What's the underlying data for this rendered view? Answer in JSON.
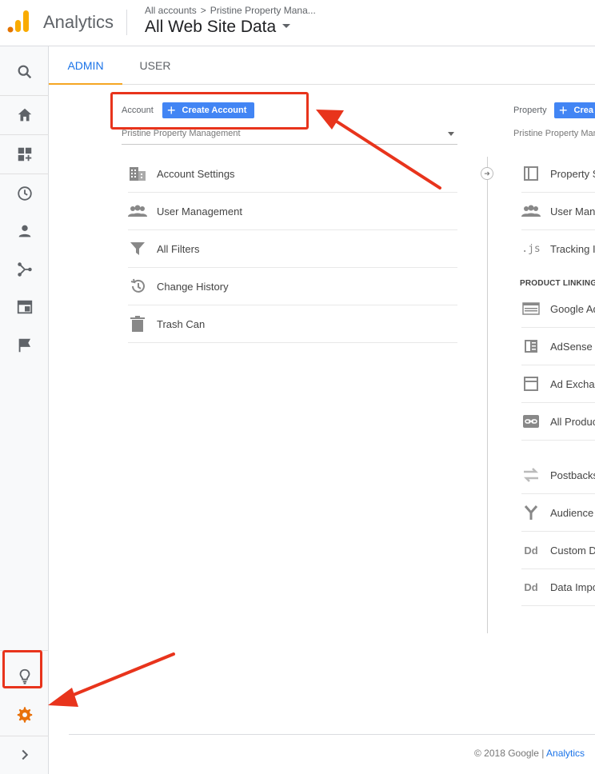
{
  "header": {
    "app_name": "Analytics",
    "breadcrumb": [
      "All accounts",
      "Pristine Property Mana..."
    ],
    "view_title": "All Web Site Data"
  },
  "left_nav": {
    "items": [
      {
        "icon": "search-icon"
      },
      {
        "icon": "home-icon"
      },
      {
        "icon": "customization-icon"
      },
      {
        "icon": "realtime-clock-icon"
      },
      {
        "icon": "audience-person-icon"
      },
      {
        "icon": "acquisition-icon"
      },
      {
        "icon": "behavior-icon"
      },
      {
        "icon": "conversions-flag-icon"
      }
    ],
    "bottom": [
      {
        "icon": "discover-lightbulb-icon"
      },
      {
        "icon": "admin-gear-icon"
      },
      {
        "icon": "expand-chevron-icon"
      }
    ]
  },
  "tabs": [
    {
      "label": "ADMIN",
      "active": true
    },
    {
      "label": "USER",
      "active": false
    }
  ],
  "account": {
    "label": "Account",
    "create_button": "Create Account",
    "selected": "Pristine Property Management",
    "items": [
      {
        "label": "Account Settings",
        "icon": "building-icon"
      },
      {
        "label": "User Management",
        "icon": "people-icon"
      },
      {
        "label": "All Filters",
        "icon": "filter-icon"
      },
      {
        "label": "Change History",
        "icon": "history-icon"
      },
      {
        "label": "Trash Can",
        "icon": "trash-icon"
      }
    ]
  },
  "property": {
    "label": "Property",
    "create_button": "Crea",
    "selected": "Pristine Property Mana",
    "items": [
      {
        "label": "Property S",
        "icon": "property-settings-icon"
      },
      {
        "label": "User Mana",
        "icon": "people-icon"
      },
      {
        "label": "Tracking In",
        "icon": "js-icon"
      }
    ],
    "section_heading": "PRODUCT LINKING",
    "linking_items": [
      {
        "label": "Google Ad",
        "icon": "google-ads-icon"
      },
      {
        "label": "AdSense L",
        "icon": "adsense-icon"
      },
      {
        "label": "Ad Exchan",
        "icon": "ad-exchange-icon"
      },
      {
        "label": "All Produc",
        "icon": "link-icon"
      }
    ],
    "other_items": [
      {
        "label": "Postbacks",
        "icon": "postbacks-icon"
      },
      {
        "label": "Audience D",
        "icon": "audience-fork-icon"
      },
      {
        "label": "Custom De",
        "icon": "dd-icon"
      },
      {
        "label": "Data Impo",
        "icon": "dd-icon"
      }
    ]
  },
  "footer": {
    "copyright": "© 2018 Google |",
    "link": "Analytics"
  },
  "colors": {
    "accent_blue": "#4285f4",
    "tab_active": "#1a73e8",
    "tab_underline": "#f5a623",
    "annotation_red": "#e8341c",
    "gear_orange": "#e8710a"
  }
}
